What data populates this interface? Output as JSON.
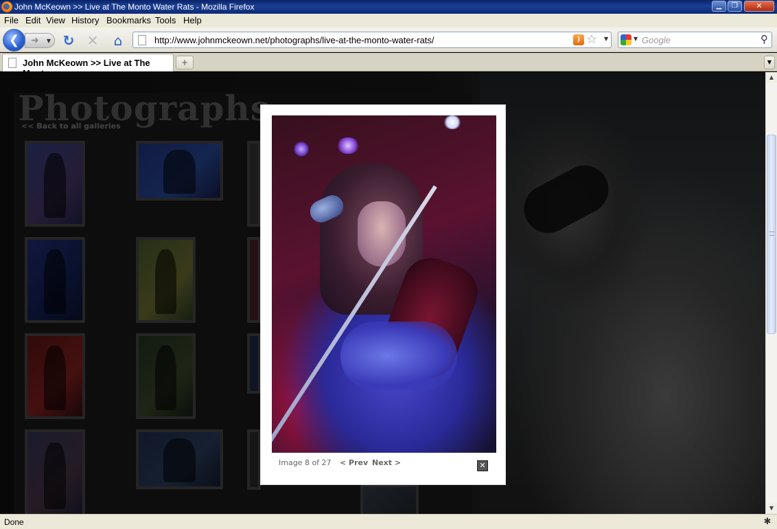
{
  "window": {
    "title": "John McKeown >> Live at The Monto Water Rats - Mozilla Firefox",
    "controls": {
      "minimize": "▁",
      "maximize": "❐",
      "close": "✕"
    }
  },
  "menu": {
    "items": [
      "File",
      "Edit",
      "View",
      "History",
      "Bookmarks",
      "Tools",
      "Help"
    ]
  },
  "navigation": {
    "url": "http://www.johnmckeown.net/photographs/live-at-the-monto-water-rats/",
    "search_placeholder": "Google",
    "icons": {
      "back": "back-arrow-icon",
      "forward": "forward-arrow-icon",
      "reload": "reload-icon",
      "stop": "stop-icon",
      "home": "home-icon",
      "rss": "rss-feed-icon",
      "bookmark": "star-icon",
      "search_engine": "google-icon",
      "search": "magnifier-icon"
    }
  },
  "tabs": [
    {
      "label": "John McKeown >> Live at The Mont...",
      "active": true
    }
  ],
  "page": {
    "heading": "Photographs",
    "back_link": "<< Back to all galleries",
    "lightbox": {
      "caption": "Image 8 of 27",
      "prev_label": "< Prev",
      "next_label": "Next >",
      "close_icon": "close-icon"
    }
  },
  "status": {
    "text": "Done"
  },
  "colors": {
    "titlebar": "#0a246a",
    "chrome": "#ece9d8",
    "page_background": "#141414",
    "heading_text": "#4a4a4a",
    "lightbox_background": "#ffffff"
  }
}
